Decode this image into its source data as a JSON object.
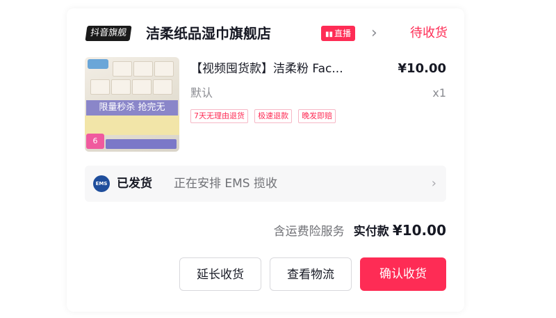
{
  "store": {
    "platform_badge": "抖音旗舰",
    "name": "洁柔纸品湿巾旗舰店",
    "live_badge": "直播",
    "status": "待收货"
  },
  "product": {
    "title": "【视频囤货款】洁柔粉 Fac...",
    "price": "¥10.00",
    "spec": "默认",
    "quantity": "x1",
    "thumb_banner": "限量秒杀 抢完无",
    "thumb_count": "6",
    "tags": [
      "7天无理由退货",
      "极速退款",
      "晚发即赔"
    ]
  },
  "shipping": {
    "carrier_icon": "EMS",
    "status": "已发货",
    "detail": "正在安排 EMS 揽收"
  },
  "total": {
    "note": "含运费险服务",
    "label": "实付款",
    "amount": "¥10.00"
  },
  "actions": {
    "extend_label": "延长收货",
    "logistics_label": "查看物流",
    "confirm_label": "确认收货"
  },
  "colors": {
    "accent": "#fe2c55",
    "text": "#161823",
    "muted": "#8a8b91"
  }
}
